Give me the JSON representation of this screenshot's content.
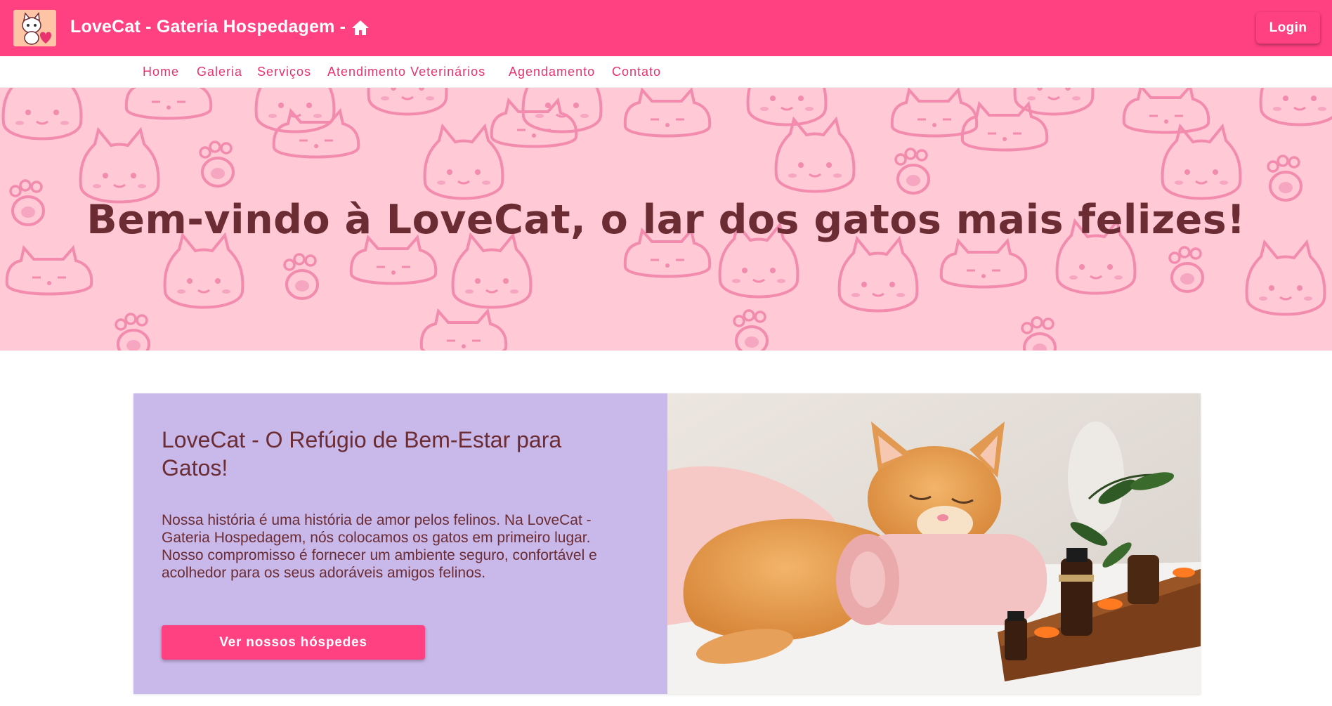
{
  "header": {
    "title": "LoveCat - Gateria Hospedagem -",
    "login_label": "Login",
    "color": "#ff4081"
  },
  "nav": {
    "items": [
      "Home",
      "Galeria",
      "Serviços",
      "Atendimento Veterinários",
      "Agendamento",
      "Contato"
    ]
  },
  "hero": {
    "title": "Bem-vindo à LoveCat, o lar dos gatos mais felizes!",
    "background_color": "#ffc9d6"
  },
  "about": {
    "title": "LoveCat - O Refúgio de Bem-Estar para Gatos!",
    "text": "Nossa história é uma história de amor pelos felinos. Na LoveCat - Gateria Hospedagem, nós colocamos os gatos em primeiro lugar. Nosso compromisso é fornecer um ambiente seguro, confortável e acolhedor para os seus adoráveis amigos felinos.",
    "button_label": "Ver nossos hóspedes",
    "panel_color": "#c9b8ea"
  },
  "icons": [
    "logo-cat",
    "home-icon",
    "cat-pattern",
    "sleeping-cat-photo"
  ]
}
